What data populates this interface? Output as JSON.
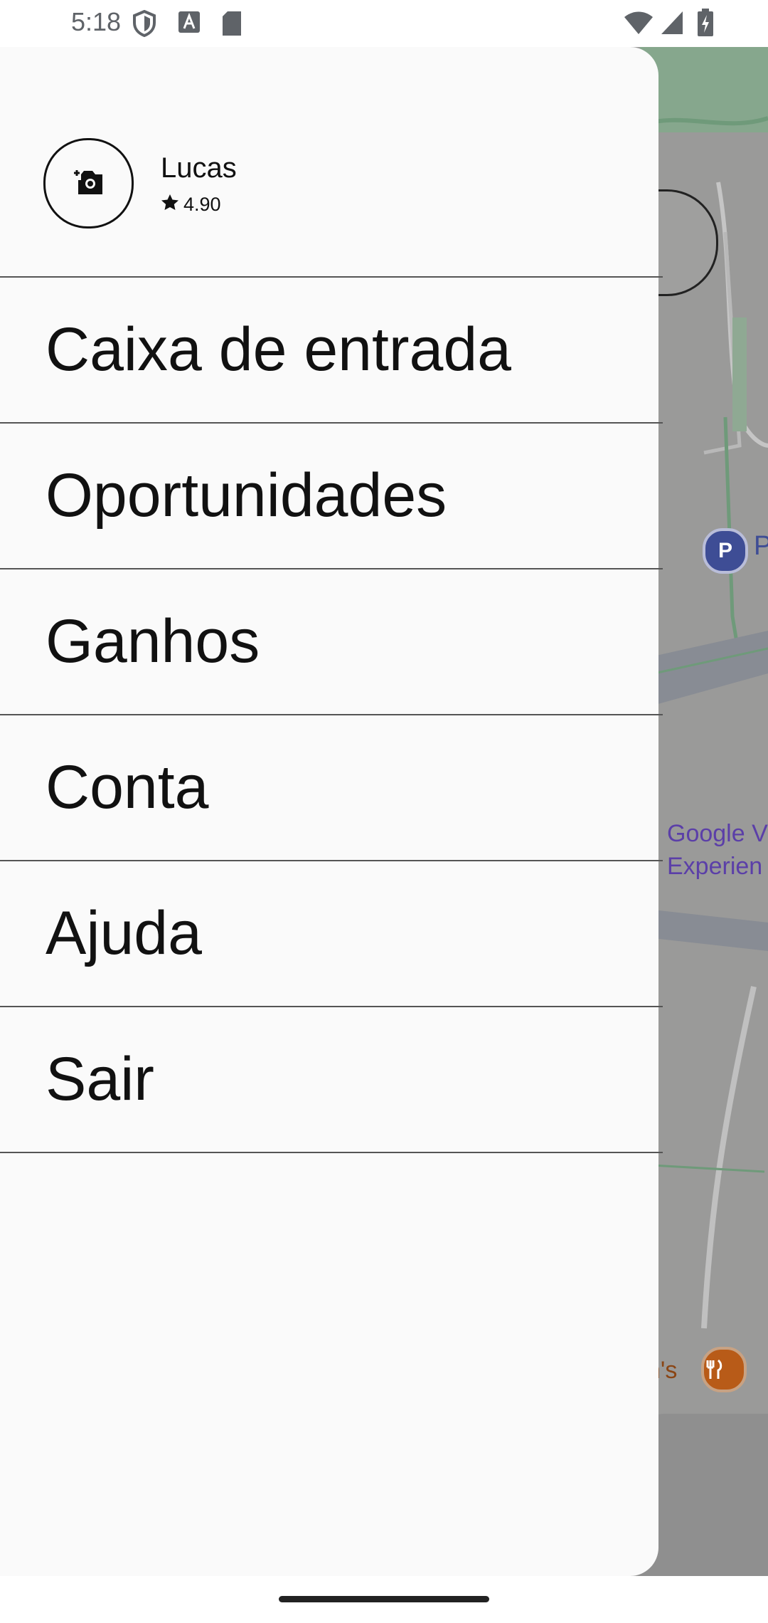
{
  "status_bar": {
    "time": "5:18",
    "icons": [
      "shield-icon",
      "a-box-icon",
      "sd-card-icon",
      "wifi-icon",
      "signal-icon",
      "battery-charging-icon"
    ]
  },
  "drawer": {
    "profile": {
      "name": "Lucas",
      "rating": "4.90",
      "avatar_icon": "add-photo-camera-icon"
    },
    "menu": [
      {
        "label": "Caixa de entrada"
      },
      {
        "label": "Oportunidades"
      },
      {
        "label": "Ganhos"
      },
      {
        "label": "Conta"
      },
      {
        "label": "Ajuda"
      },
      {
        "label": "Sair"
      }
    ]
  },
  "map": {
    "parking_badge": "P",
    "parking_label": "P",
    "place_label_line1": "Google V",
    "place_label_line2": "Experien",
    "restaurant_label": "n's"
  },
  "colors": {
    "drawer_bg": "#fafafa",
    "map_dim": "#9a9a99",
    "divider": "#555555",
    "parking": "#3e4d95",
    "restaurant": "#b85b18"
  }
}
